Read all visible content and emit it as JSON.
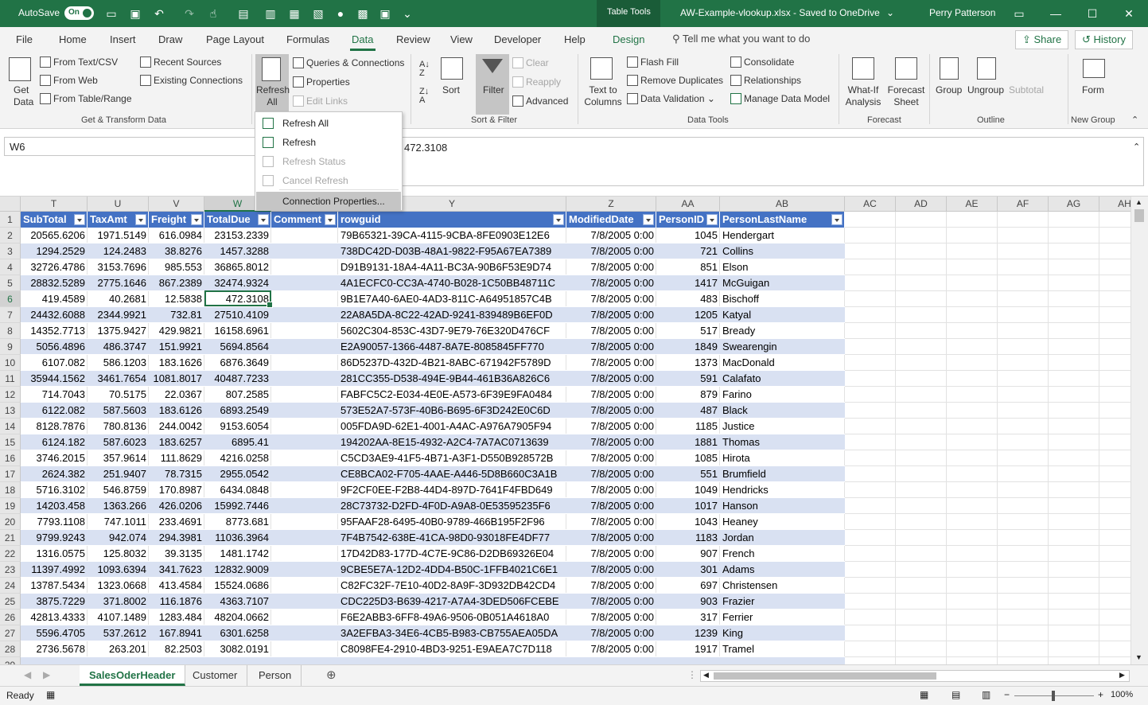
{
  "titlebar": {
    "autosave_label": "AutoSave",
    "autosave_state": "On",
    "context_tab": "Table Tools",
    "document_title": "AW-Example-vlookup.xlsx  -  Saved to OneDrive",
    "user_name": "Perry Patterson"
  },
  "menu": {
    "tabs": [
      "File",
      "Home",
      "Insert",
      "Draw",
      "Page Layout",
      "Formulas",
      "Data",
      "Review",
      "View",
      "Developer",
      "Help"
    ],
    "active_tab": "Data",
    "design_tab": "Design",
    "tell_me": "Tell me what you want to do",
    "share_label": "Share",
    "history_label": "History"
  },
  "ribbon": {
    "get_data": "Get Data",
    "from_text_csv": "From Text/CSV",
    "from_web": "From Web",
    "from_table_range": "From Table/Range",
    "recent_sources": "Recent Sources",
    "existing_connections": "Existing Connections",
    "group_get_transform": "Get & Transform Data",
    "refresh_all": "Refresh All",
    "queries_connections": "Queries & Connections",
    "properties": "Properties",
    "edit_links": "Edit Links",
    "sort": "Sort",
    "filter": "Filter",
    "clear": "Clear",
    "reapply": "Reapply",
    "advanced": "Advanced",
    "group_sort_filter": "Sort & Filter",
    "text_to_columns": "Text to Columns",
    "flash_fill": "Flash Fill",
    "remove_duplicates": "Remove Duplicates",
    "data_validation": "Data Validation",
    "consolidate": "Consolidate",
    "relationships": "Relationships",
    "manage_data_model": "Manage Data Model",
    "group_data_tools": "Data Tools",
    "what_if": "What-If Analysis",
    "forecast_sheet": "Forecast Sheet",
    "group_forecast": "Forecast",
    "group_btn": "Group",
    "ungroup": "Ungroup",
    "subtotal": "Subtotal",
    "group_outline": "Outline",
    "form": "Form",
    "group_new": "New Group"
  },
  "dropdown": {
    "items": [
      {
        "label": "Refresh All",
        "enabled": true
      },
      {
        "label": "Refresh",
        "enabled": true
      },
      {
        "label": "Refresh Status",
        "enabled": false
      },
      {
        "label": "Cancel Refresh",
        "enabled": false
      },
      {
        "label": "Connection Properties...",
        "enabled": true
      }
    ]
  },
  "formula_bar": {
    "name_box": "W6",
    "formula": "472.3108"
  },
  "columns": [
    "T",
    "U",
    "V",
    "W",
    "X",
    "Y",
    "Z",
    "AA",
    "AB",
    "AC",
    "AD",
    "AE",
    "AF",
    "AG",
    "AH"
  ],
  "selected_column": "W",
  "selected_row": "6",
  "table": {
    "headers": [
      "SubTotal",
      "TaxAmt",
      "Freight",
      "TotalDue",
      "Comment",
      "rowguid",
      "ModifiedDate",
      "PersonID",
      "PersonLastName"
    ],
    "rows": [
      [
        "20565.6206",
        "1971.5149",
        "616.0984",
        "23153.2339",
        "",
        "79B65321-39CA-4115-9CBA-8FE0903E12E6",
        "7/8/2005 0:00",
        "1045",
        "Hendergart"
      ],
      [
        "1294.2529",
        "124.2483",
        "38.8276",
        "1457.3288",
        "",
        "738DC42D-D03B-48A1-9822-F95A67EA7389",
        "7/8/2005 0:00",
        "721",
        "Collins"
      ],
      [
        "32726.4786",
        "3153.7696",
        "985.553",
        "36865.8012",
        "",
        "D91B9131-18A4-4A11-BC3A-90B6F53E9D74",
        "7/8/2005 0:00",
        "851",
        "Elson"
      ],
      [
        "28832.5289",
        "2775.1646",
        "867.2389",
        "32474.9324",
        "",
        "4A1ECFC0-CC3A-4740-B028-1C50BB48711C",
        "7/8/2005 0:00",
        "1417",
        "McGuigan"
      ],
      [
        "419.4589",
        "40.2681",
        "12.5838",
        "472.3108",
        "",
        "9B1E7A40-6AE0-4AD3-811C-A64951857C4B",
        "7/8/2005 0:00",
        "483",
        "Bischoff"
      ],
      [
        "24432.6088",
        "2344.9921",
        "732.81",
        "27510.4109",
        "",
        "22A8A5DA-8C22-42AD-9241-839489B6EF0D",
        "7/8/2005 0:00",
        "1205",
        "Katyal"
      ],
      [
        "14352.7713",
        "1375.9427",
        "429.9821",
        "16158.6961",
        "",
        "5602C304-853C-43D7-9E79-76E320D476CF",
        "7/8/2005 0:00",
        "517",
        "Bready"
      ],
      [
        "5056.4896",
        "486.3747",
        "151.9921",
        "5694.8564",
        "",
        "E2A90057-1366-4487-8A7E-8085845FF770",
        "7/8/2005 0:00",
        "1849",
        "Swearengin"
      ],
      [
        "6107.082",
        "586.1203",
        "183.1626",
        "6876.3649",
        "",
        "86D5237D-432D-4B21-8ABC-671942F5789D",
        "7/8/2005 0:00",
        "1373",
        "MacDonald"
      ],
      [
        "35944.1562",
        "3461.7654",
        "1081.8017",
        "40487.7233",
        "",
        "281CC355-D538-494E-9B44-461B36A826C6",
        "7/8/2005 0:00",
        "591",
        "Calafato"
      ],
      [
        "714.7043",
        "70.5175",
        "22.0367",
        "807.2585",
        "",
        "FABFC5C2-E034-4E0E-A573-6F39E9FA0484",
        "7/8/2005 0:00",
        "879",
        "Farino"
      ],
      [
        "6122.082",
        "587.5603",
        "183.6126",
        "6893.2549",
        "",
        "573E52A7-573F-40B6-B695-6F3D242E0C6D",
        "7/8/2005 0:00",
        "487",
        "Black"
      ],
      [
        "8128.7876",
        "780.8136",
        "244.0042",
        "9153.6054",
        "",
        "005FDA9D-62E1-4001-A4AC-A976A7905F94",
        "7/8/2005 0:00",
        "1185",
        "Justice"
      ],
      [
        "6124.182",
        "587.6023",
        "183.6257",
        "6895.41",
        "",
        "194202AA-8E15-4932-A2C4-7A7AC0713639",
        "7/8/2005 0:00",
        "1881",
        "Thomas"
      ],
      [
        "3746.2015",
        "357.9614",
        "111.8629",
        "4216.0258",
        "",
        "C5CD3AE9-41F5-4B71-A3F1-D550B928572B",
        "7/8/2005 0:00",
        "1085",
        "Hirota"
      ],
      [
        "2624.382",
        "251.9407",
        "78.7315",
        "2955.0542",
        "",
        "CE8BCA02-F705-4AAE-A446-5D8B660C3A1B",
        "7/8/2005 0:00",
        "551",
        "Brumfield"
      ],
      [
        "5716.3102",
        "546.8759",
        "170.8987",
        "6434.0848",
        "",
        "9F2CF0EE-F2B8-44D4-897D-7641F4FBD649",
        "7/8/2005 0:00",
        "1049",
        "Hendricks"
      ],
      [
        "14203.458",
        "1363.266",
        "426.0206",
        "15992.7446",
        "",
        "28C73732-D2FD-4F0D-A9A8-0E53595235F6",
        "7/8/2005 0:00",
        "1017",
        "Hanson"
      ],
      [
        "7793.1108",
        "747.1011",
        "233.4691",
        "8773.681",
        "",
        "95FAAF28-6495-40B0-9789-466B195F2F96",
        "7/8/2005 0:00",
        "1043",
        "Heaney"
      ],
      [
        "9799.9243",
        "942.074",
        "294.3981",
        "11036.3964",
        "",
        "7F4B7542-638E-41CA-98D0-93018FE4DF77",
        "7/8/2005 0:00",
        "1183",
        "Jordan"
      ],
      [
        "1316.0575",
        "125.8032",
        "39.3135",
        "1481.1742",
        "",
        "17D42D83-177D-4C7E-9C86-D2DB69326E04",
        "7/8/2005 0:00",
        "907",
        "French"
      ],
      [
        "11397.4992",
        "1093.6394",
        "341.7623",
        "12832.9009",
        "",
        "9CBE5E7A-12D2-4DD4-B50C-1FFB4021C6E1",
        "7/8/2005 0:00",
        "301",
        "Adams"
      ],
      [
        "13787.5434",
        "1323.0668",
        "413.4584",
        "15524.0686",
        "",
        "C82FC32F-7E10-40D2-8A9F-3D932DB42CD4",
        "7/8/2005 0:00",
        "697",
        "Christensen"
      ],
      [
        "3875.7229",
        "371.8002",
        "116.1876",
        "4363.7107",
        "",
        "CDC225D3-B639-4217-A7A4-3DED506FCEBE",
        "7/8/2005 0:00",
        "903",
        "Frazier"
      ],
      [
        "42813.4333",
        "4107.1489",
        "1283.484",
        "48204.0662",
        "",
        "F6E2ABB3-6FF8-49A6-9506-0B051A4618A0",
        "7/8/2005 0:00",
        "317",
        "Ferrier"
      ],
      [
        "5596.4705",
        "537.2612",
        "167.8941",
        "6301.6258",
        "",
        "3A2EFBA3-34E6-4CB5-B983-CB755AEA05DA",
        "7/8/2005 0:00",
        "1239",
        "King"
      ],
      [
        "2736.5678",
        "263.201",
        "82.2503",
        "3082.0191",
        "",
        "C8098FE4-2910-4BD3-9251-E9AEA7C7D118",
        "7/8/2005 0:00",
        "1917",
        "Tramel"
      ]
    ]
  },
  "sheets": {
    "tabs": [
      "SalesOderHeader",
      "Customer",
      "Person"
    ],
    "active": "SalesOderHeader"
  },
  "status": {
    "ready": "Ready",
    "zoom": "100%"
  },
  "colors": {
    "excel_green": "#217346",
    "table_header": "#4472c4",
    "table_band": "#d9e1f2"
  }
}
